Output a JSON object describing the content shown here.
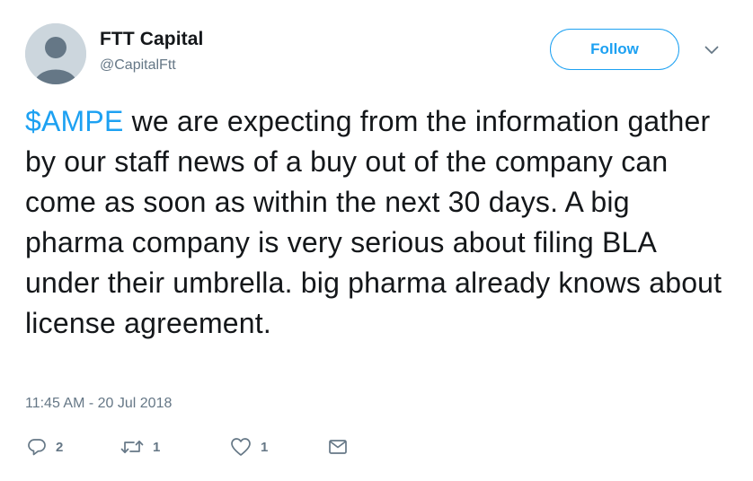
{
  "tweet": {
    "author": {
      "name": "FTT Capital",
      "handle": "@CapitalFtt"
    },
    "follow_label": "Follow",
    "text": {
      "cashtag": "$AMPE",
      "rest": " we are expecting from the information gather by our staff news of a buy out of the company can come as soon as within the next 30 days. A big pharma company is very serious about filing BLA under their umbrella. big pharma already knows about license agreement."
    },
    "timestamp": "11:45 AM - 20 Jul 2018",
    "actions": {
      "reply": {
        "icon": "reply-icon",
        "count": "2"
      },
      "retweet": {
        "icon": "retweet-icon",
        "count": "1"
      },
      "like": {
        "icon": "heart-icon",
        "count": "1"
      },
      "message": {
        "icon": "envelope-icon"
      }
    }
  },
  "colors": {
    "accent": "#1da1f2",
    "text": "#14171a",
    "muted": "#657786",
    "avatar_bg": "#ccd6dd"
  }
}
